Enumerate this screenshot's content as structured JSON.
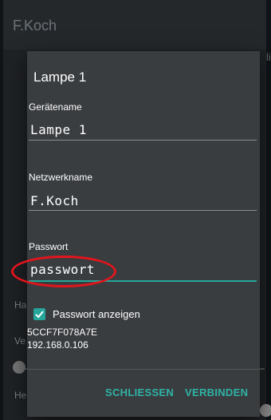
{
  "background": {
    "app_title": "F.Koch",
    "side_label": "list",
    "left_labels": [
      "Ha",
      "Ve",
      "He"
    ]
  },
  "dialog": {
    "title": "Lampe 1",
    "device_name": {
      "label": "Gerätename",
      "value": "Lampe 1"
    },
    "network_name": {
      "label": "Netzwerkname",
      "value": "F.Koch"
    },
    "password": {
      "label": "Passwort",
      "value": "passwort"
    },
    "show_password": {
      "label": "Passwort anzeigen",
      "checked": true
    },
    "mac_address": "5CCF7F078A7E",
    "ip_address": "192.168.0.106",
    "buttons": {
      "close": "SCHLIESSEN",
      "connect": "VERBINDEN"
    }
  },
  "colors": {
    "accent": "#26a69a",
    "highlight": "#e5141c",
    "dialog_bg": "#3a3d40"
  }
}
